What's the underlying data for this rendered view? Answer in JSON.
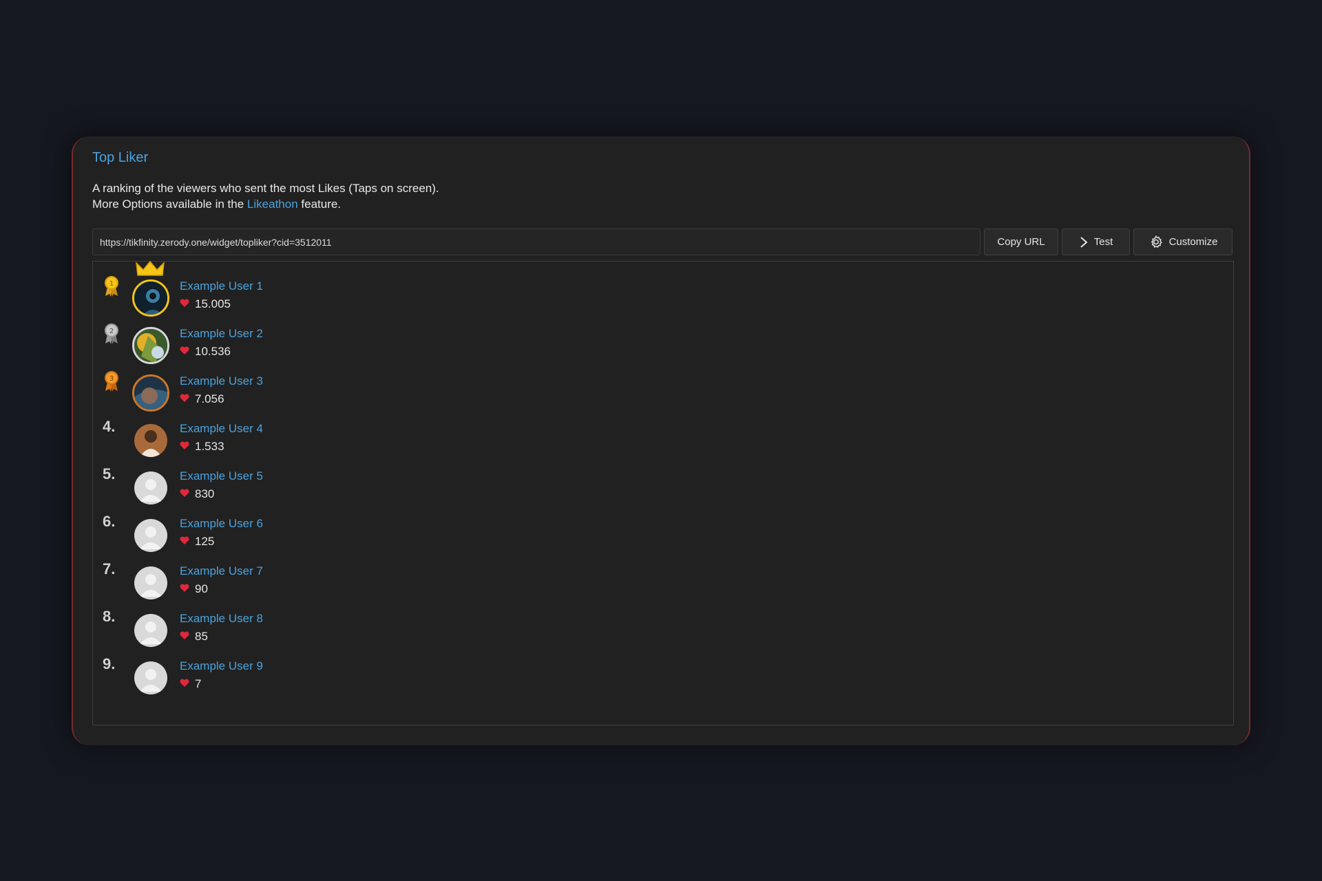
{
  "widget_card": {
    "title": "Top Liker",
    "description_line1": "A ranking of the viewers who sent the most Likes (Taps on screen).",
    "description_line2_prefix": "More Options available in the",
    "description_link": "Likeathon",
    "description_line2_suffix": "feature."
  },
  "toolbar": {
    "url_value": "https://tikfinity.zerody.one/widget/topliker?cid=3512011",
    "copy_label": "Copy URL",
    "test_label": "Test",
    "customize_label": "Customize"
  },
  "colors": {
    "background": "#161821",
    "card": "#212121",
    "accent": "#4aa3df",
    "heart": "#e0283a",
    "gold": "#f5c518"
  },
  "leaderboard": [
    {
      "rank": "1",
      "name": "Example User 1",
      "likes": "15.005",
      "medal": "gold-medal-icon",
      "crown": true
    },
    {
      "rank": "2",
      "name": "Example User 2",
      "likes": "10.536",
      "medal": "silver-medal-icon"
    },
    {
      "rank": "3",
      "name": "Example User 3",
      "likes": "7.056",
      "medal": "bronze-medal-icon"
    },
    {
      "rank": "4.",
      "name": "Example User 4",
      "likes": "1.533"
    },
    {
      "rank": "5.",
      "name": "Example User 5",
      "likes": "830"
    },
    {
      "rank": "6.",
      "name": "Example User 6",
      "likes": "125"
    },
    {
      "rank": "7.",
      "name": "Example User 7",
      "likes": "90"
    },
    {
      "rank": "8.",
      "name": "Example User 8",
      "likes": "85"
    },
    {
      "rank": "9.",
      "name": "Example User 9",
      "likes": "7"
    }
  ]
}
